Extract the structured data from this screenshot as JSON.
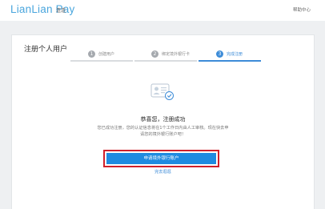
{
  "header": {
    "logo_text": "LianLian Pay",
    "logo_sub": "连连",
    "help_link": "帮助中心"
  },
  "card": {
    "title": "注册个人用户",
    "steps": [
      {
        "num": "1",
        "label": "创建用户",
        "active": false
      },
      {
        "num": "2",
        "label": "绑定境外银行卡",
        "active": false
      },
      {
        "num": "3",
        "label": "完成注册",
        "active": true
      }
    ],
    "success_title": "恭喜您，注册成功",
    "success_desc": "您已成功注册，您的认证信息将在1个工作日内由人工审核。现在快去申请您的境外银行账户吧！",
    "cta_label": "申请境外银行账户",
    "later_link": "完去逛逛"
  },
  "colors": {
    "brand": "#4aa6dd",
    "primary": "#1f8be0",
    "highlight": "#d0202a"
  }
}
